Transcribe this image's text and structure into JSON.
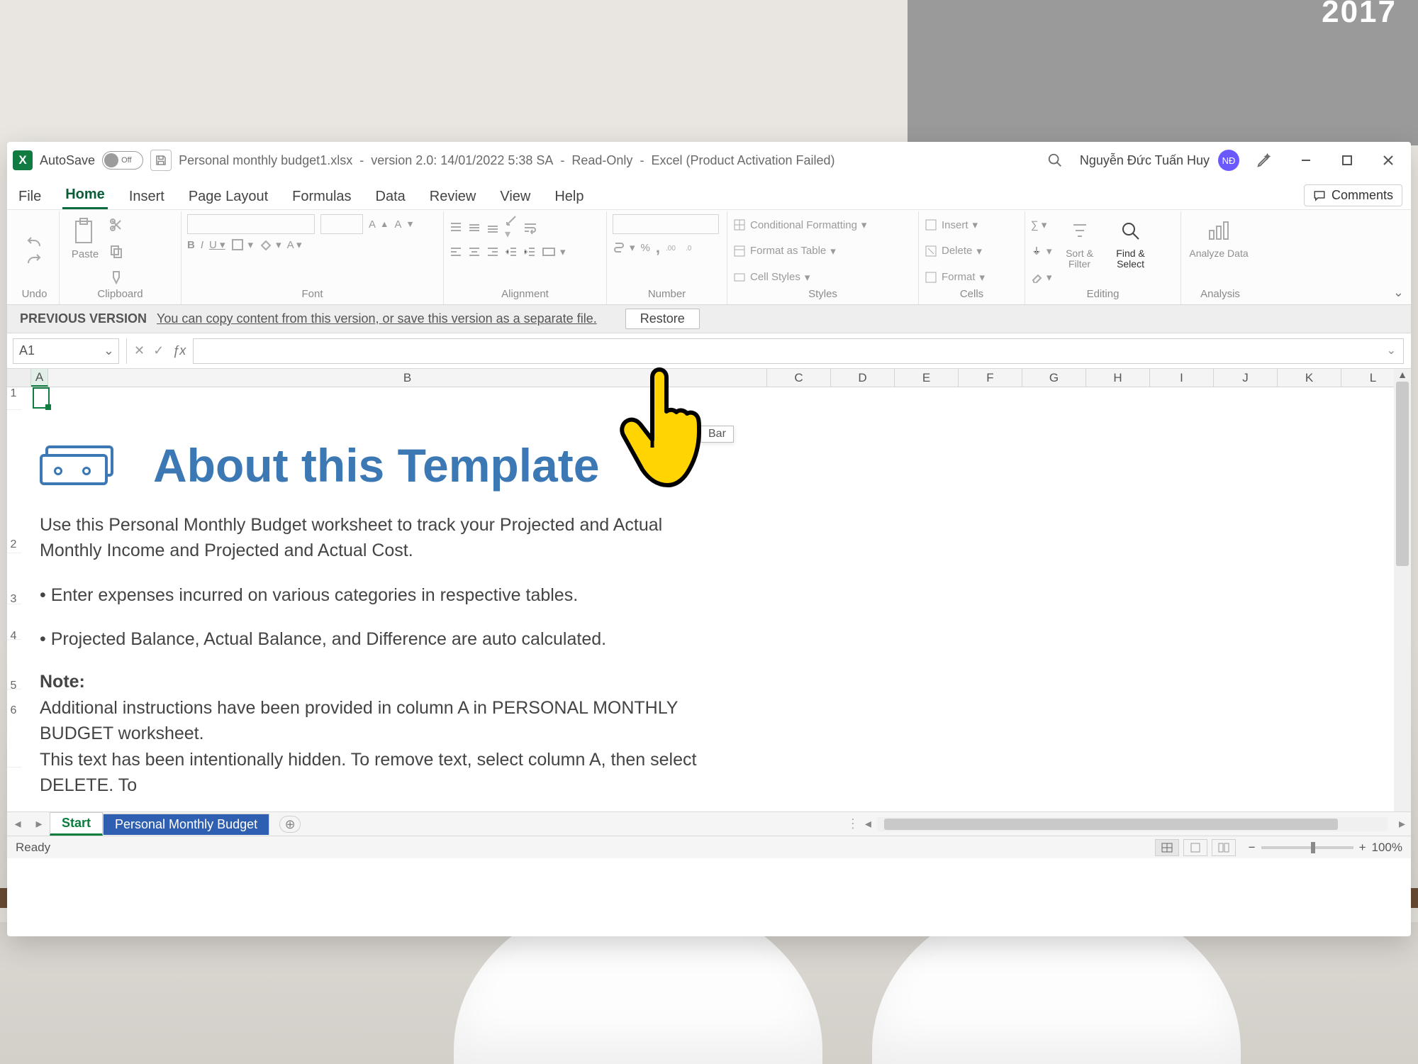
{
  "desktop": {
    "poster_year": "2017"
  },
  "titlebar": {
    "autosave_label": "AutoSave",
    "autosave_state": "Off",
    "filename": "Personal monthly budget1.xlsx",
    "version_part": "version 2.0: 14/01/2022 5:38 SA",
    "readonly": "Read-Only",
    "product": "Excel (Product Activation Failed)",
    "user_name": "Nguyễn Đức Tuấn Huy",
    "user_initials": "NĐ"
  },
  "tabs": {
    "file": "File",
    "home": "Home",
    "insert": "Insert",
    "page_layout": "Page Layout",
    "formulas": "Formulas",
    "data": "Data",
    "review": "Review",
    "view": "View",
    "help": "Help",
    "comments": "Comments"
  },
  "ribbon": {
    "undo": "Undo",
    "clipboard": "Clipboard",
    "paste": "Paste",
    "font": "Font",
    "alignment": "Alignment",
    "number": "Number",
    "styles": "Styles",
    "cond_fmt": "Conditional Formatting",
    "fmt_table": "Format as Table",
    "cell_styles": "Cell Styles",
    "cells": "Cells",
    "insert": "Insert",
    "delete": "Delete",
    "format": "Format",
    "editing": "Editing",
    "sort_filter": "Sort & Filter",
    "find_select": "Find & Select",
    "analysis": "Analysis",
    "analyze_data": "Analyze Data",
    "percent": "%",
    "comma": ","
  },
  "versionbar": {
    "header": "PREVIOUS VERSION",
    "message": "You can copy content from this version, or save this version as a separate file.",
    "restore": "Restore"
  },
  "formula": {
    "name_box": "A1"
  },
  "tooltip": {
    "text": "Bar"
  },
  "columns": [
    "A",
    "B",
    "C",
    "D",
    "E",
    "F",
    "G",
    "H",
    "I",
    "J",
    "K",
    "L"
  ],
  "rows": [
    "1",
    "2",
    "3",
    "4",
    "5",
    "6"
  ],
  "doc": {
    "title": "About this Template",
    "p1": "Use this Personal Monthly Budget worksheet to track your Projected and Actual Monthly Income and Projected and Actual Cost.",
    "p2": "• Enter expenses incurred on various categories in respective tables.",
    "p3": "• Projected Balance, Actual Balance, and Difference are auto calculated.",
    "note_h": "Note:",
    "note1": "Additional instructions have been provided in column A in PERSONAL MONTHLY BUDGET worksheet.",
    "note2": "This text has been intentionally hidden. To remove text, select column A, then select DELETE. To"
  },
  "sheets": {
    "start": "Start",
    "pmb": "Personal Monthly Budget"
  },
  "status": {
    "ready": "Ready",
    "zoom": "100%"
  }
}
